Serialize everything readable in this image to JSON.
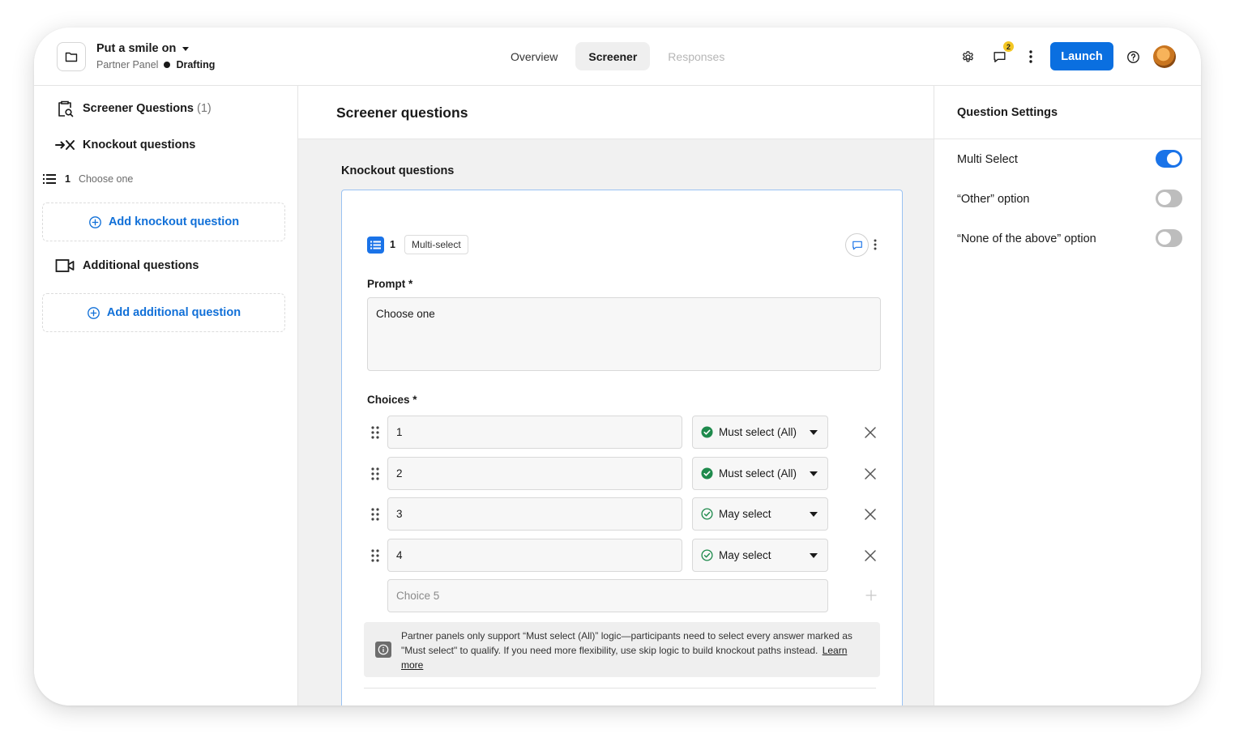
{
  "header": {
    "project_title": "Put a smile on",
    "panel_name": "Partner Panel",
    "status": "Drafting",
    "tabs": [
      {
        "label": "Overview"
      },
      {
        "label": "Screener"
      },
      {
        "label": "Responses"
      }
    ],
    "active_tab": "Screener",
    "notification_count": "2",
    "launch_label": "Launch",
    "icons": [
      "folder-icon",
      "caret-down-icon",
      "gear-icon",
      "comment-icon",
      "more-vertical-icon",
      "help-icon",
      "avatar"
    ]
  },
  "sidebar": {
    "screener_label": "Screener Questions",
    "screener_count": "(1)",
    "knockout_label": "Knockout questions",
    "knockout_items": [
      {
        "num": "1",
        "label": "Choose one"
      }
    ],
    "add_knockout_label": "Add knockout question",
    "additional_label": "Additional questions",
    "add_additional_label": "Add additional question"
  },
  "main": {
    "title": "Screener questions",
    "section_label": "Knockout questions",
    "question": {
      "number": "1",
      "type": "Multi-select",
      "prompt_label": "Prompt *",
      "prompt_value": "Choose one",
      "choices_label": "Choices *",
      "choices": [
        {
          "value": "1",
          "rule": "Must select (All)",
          "rule_kind": "must"
        },
        {
          "value": "2",
          "rule": "Must select (All)",
          "rule_kind": "must"
        },
        {
          "value": "3",
          "rule": "May select",
          "rule_kind": "may"
        },
        {
          "value": "4",
          "rule": "May select",
          "rule_kind": "may"
        }
      ],
      "new_choice_placeholder": "Choice 5",
      "info_text": "Partner panels only support “Must select (All)” logic—participants need to select every answer marked as \"Must select\" to qualify. If you need more flexibility, use skip logic to build knockout paths instead.",
      "info_link": "Learn more"
    }
  },
  "settings": {
    "title": "Question Settings",
    "items": [
      {
        "label": "Multi Select",
        "enabled": true
      },
      {
        "label": "“Other” option",
        "enabled": false
      },
      {
        "label": "“None of the above” option",
        "enabled": false
      }
    ]
  },
  "colors": {
    "accent": "#1a73e8",
    "launch": "#0a6fe0",
    "must_select": "#1e8a4c",
    "badge": "#f3c623"
  }
}
